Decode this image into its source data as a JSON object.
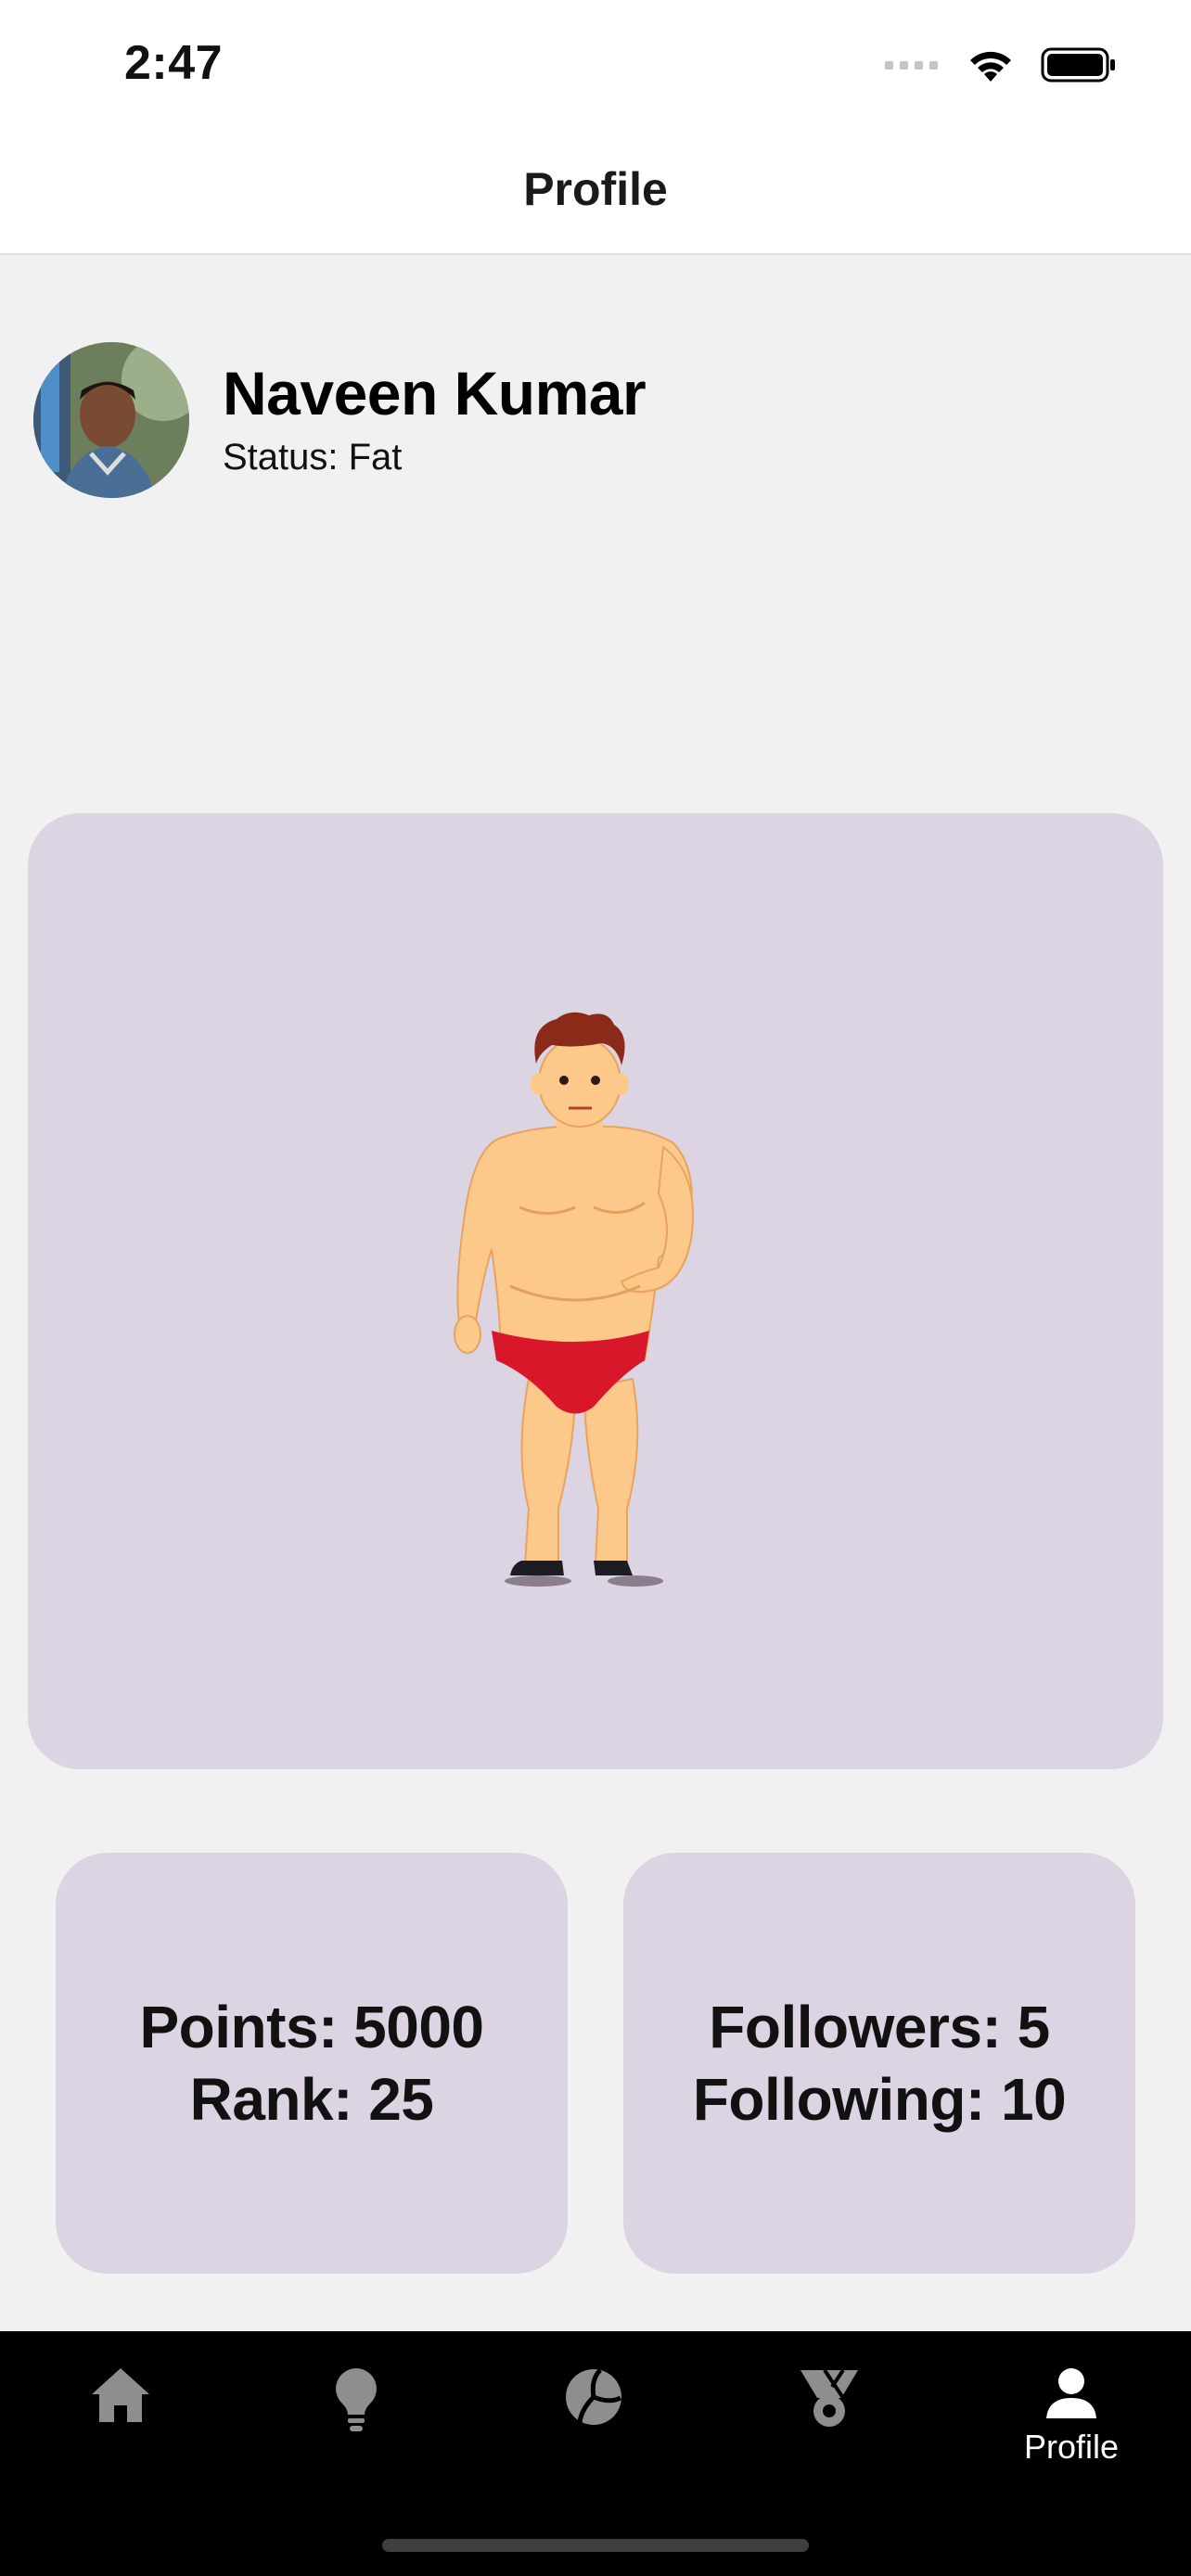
{
  "status_bar": {
    "time": "2:47",
    "icons": [
      "signal-dots-icon",
      "wifi-icon",
      "battery-icon"
    ]
  },
  "header": {
    "title": "Profile"
  },
  "profile": {
    "name": "Naveen Kumar",
    "status": "Status: Fat"
  },
  "stats": {
    "points": "Points: 5000",
    "rank": "Rank: 25",
    "followers": "Followers: 5",
    "following": "Following: 10"
  },
  "tab_bar": {
    "items": [
      {
        "icon": "home-icon",
        "label": ""
      },
      {
        "icon": "lightbulb-icon",
        "label": ""
      },
      {
        "icon": "volleyball-icon",
        "label": ""
      },
      {
        "icon": "medal-icon",
        "label": ""
      },
      {
        "icon": "person-icon",
        "label": "Profile",
        "selected": true
      }
    ]
  },
  "colors": {
    "card_background": "#ddd4e3",
    "page_background": "#f1f1f1",
    "tab_bar_background": "#000000",
    "tab_icon_inactive": "#8e8e8e",
    "tab_icon_active": "#ffffff"
  }
}
